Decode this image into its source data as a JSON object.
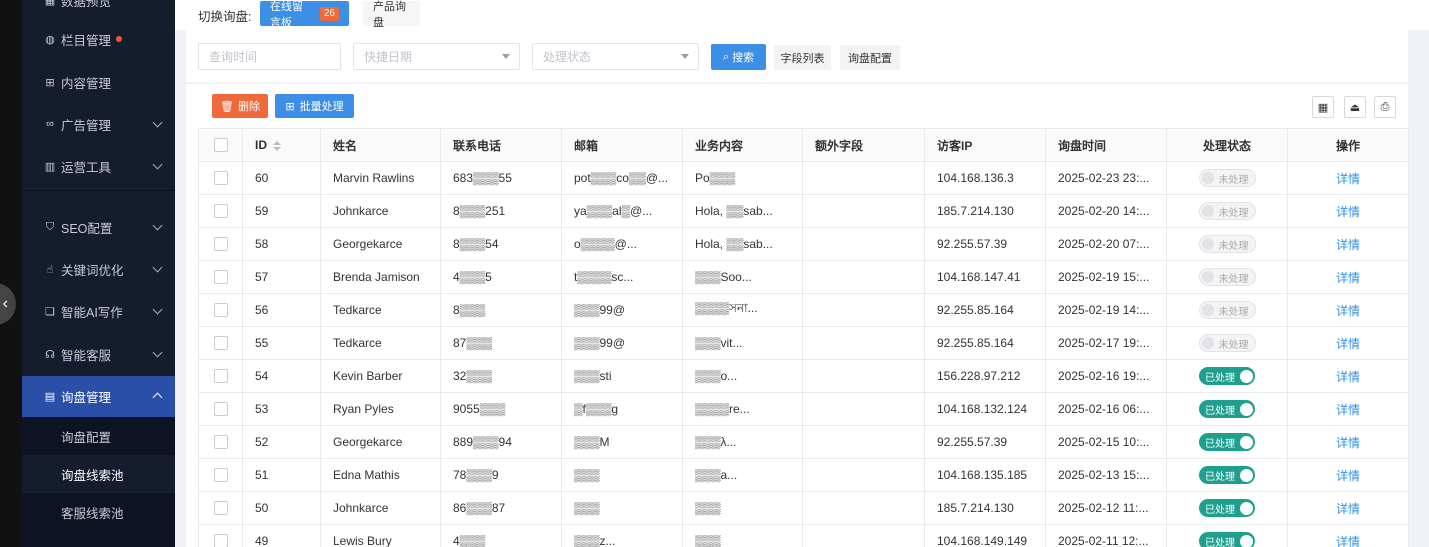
{
  "sidebar": {
    "items": [
      {
        "label": "数据预览",
        "icon": "dashboard-icon"
      },
      {
        "label": "栏目管理",
        "icon": "globe-icon",
        "dot": true
      },
      {
        "label": "内容管理",
        "icon": "content-icon"
      },
      {
        "label": "广告管理",
        "icon": "ad-icon"
      },
      {
        "label": "运营工具",
        "icon": "tools-icon"
      },
      {
        "label": "SEO配置",
        "icon": "shield-icon"
      },
      {
        "label": "关键词优化",
        "icon": "keyword-icon"
      },
      {
        "label": "智能AI写作",
        "icon": "book-icon"
      },
      {
        "label": "智能客服",
        "icon": "headset-icon"
      },
      {
        "label": "询盘管理",
        "icon": "inquiry-icon"
      }
    ],
    "sub_items": [
      {
        "label": "询盘配置"
      },
      {
        "label": "询盘线索池"
      },
      {
        "label": "客服线索池"
      }
    ]
  },
  "topbar": {
    "label": "切换询盘:",
    "tabs": [
      {
        "label": "在线留言板",
        "badge": "26"
      },
      {
        "label": "产品询盘"
      }
    ]
  },
  "filters": {
    "query_time_placeholder": "查询时间",
    "quick_date_placeholder": "快捷日期",
    "status_placeholder": "处理状态",
    "search_label": "搜索",
    "fields_label": "字段列表",
    "config_label": "询盘配置"
  },
  "actions": {
    "delete_label": "删除",
    "batch_label": "批量处理"
  },
  "table": {
    "headers": [
      "ID",
      "姓名",
      "联系电话",
      "邮箱",
      "业务内容",
      "额外字段",
      "访客IP",
      "询盘时间",
      "处理状态",
      "操作"
    ],
    "rows": [
      {
        "id": "60",
        "name": "Marvin Rawlins",
        "phone": "683▒▒▒55",
        "email": "pot▒▒▒co▒▒@...",
        "content": "Po▒▒▒",
        "extra": "",
        "ip": "104.168.136.3",
        "time": "2025-02-23 23:...",
        "status": "未处理",
        "done": false,
        "action": "详情"
      },
      {
        "id": "59",
        "name": "Johnkarce",
        "phone": "8▒▒▒251",
        "email": "ya▒▒▒al▒@...",
        "content": "Hola, ▒▒sab...",
        "extra": "",
        "ip": "185.7.214.130",
        "time": "2025-02-20 14:...",
        "status": "未处理",
        "done": false,
        "action": "详情"
      },
      {
        "id": "58",
        "name": "Georgekarce",
        "phone": "8▒▒▒54",
        "email": "o▒▒▒▒@...",
        "content": "Hola, ▒▒sab...",
        "extra": "",
        "ip": "92.255.57.39",
        "time": "2025-02-20 07:...",
        "status": "未处理",
        "done": false,
        "action": "详情"
      },
      {
        "id": "57",
        "name": "Brenda Jamison",
        "phone": "4▒▒▒5",
        "email": "t▒▒▒▒sc...",
        "content": "▒▒▒Soo...",
        "extra": "",
        "ip": "104.168.147.41",
        "time": "2025-02-19 15:...",
        "status": "未处理",
        "done": false,
        "action": "详情"
      },
      {
        "id": "56",
        "name": "Tedkarce",
        "phone": "8▒▒▒",
        "email": "▒▒▒99@",
        "content": "▒▒▒▒সনা...",
        "extra": "",
        "ip": "92.255.85.164",
        "time": "2025-02-19 14:...",
        "status": "未处理",
        "done": false,
        "action": "详情"
      },
      {
        "id": "55",
        "name": "Tedkarce",
        "phone": "87▒▒▒",
        "email": "▒▒▒99@",
        "content": "▒▒▒vit...",
        "extra": "",
        "ip": "92.255.85.164",
        "time": "2025-02-17 19:...",
        "status": "未处理",
        "done": false,
        "action": "详情"
      },
      {
        "id": "54",
        "name": "Kevin Barber",
        "phone": "32▒▒▒",
        "email": "▒▒▒sti",
        "content": "▒▒▒o...",
        "extra": "",
        "ip": "156.228.97.212",
        "time": "2025-02-16 19:...",
        "status": "已处理",
        "done": true,
        "action": "详情"
      },
      {
        "id": "53",
        "name": "Ryan Pyles",
        "phone": "9055▒▒▒",
        "email": "▒f▒▒▒g",
        "content": "▒▒▒▒re...",
        "extra": "",
        "ip": "104.168.132.124",
        "time": "2025-02-16 06:...",
        "status": "已处理",
        "done": true,
        "action": "详情"
      },
      {
        "id": "52",
        "name": "Georgekarce",
        "phone": "889▒▒▒94",
        "email": "▒▒▒M",
        "content": "▒▒▒λ...",
        "extra": "",
        "ip": "92.255.57.39",
        "time": "2025-02-15 10:...",
        "status": "已处理",
        "done": true,
        "action": "详情"
      },
      {
        "id": "51",
        "name": "Edna Mathis",
        "phone": "78▒▒▒9",
        "email": "▒▒▒",
        "content": "▒▒▒a...",
        "extra": "",
        "ip": "104.168.135.185",
        "time": "2025-02-13 15:...",
        "status": "已处理",
        "done": true,
        "action": "详情"
      },
      {
        "id": "50",
        "name": "Johnkarce",
        "phone": "86▒▒▒87",
        "email": "▒▒▒",
        "content": "▒▒▒",
        "extra": "",
        "ip": "185.7.214.130",
        "time": "2025-02-12 11:...",
        "status": "已处理",
        "done": true,
        "action": "详情"
      },
      {
        "id": "49",
        "name": "Lewis Bury",
        "phone": "4▒▒▒",
        "email": "▒▒▒z...",
        "content": "▒▒▒",
        "extra": "",
        "ip": "104.168.149.149",
        "time": "2025-02-11 12:...",
        "status": "已处理",
        "done": true,
        "action": "详情"
      }
    ]
  },
  "colors": {
    "primary": "#3d8fe6",
    "danger": "#f0693a",
    "done": "#1fa08e",
    "sidebar_bg": "#151c2e",
    "sidebar_active": "#2a4fa8"
  }
}
